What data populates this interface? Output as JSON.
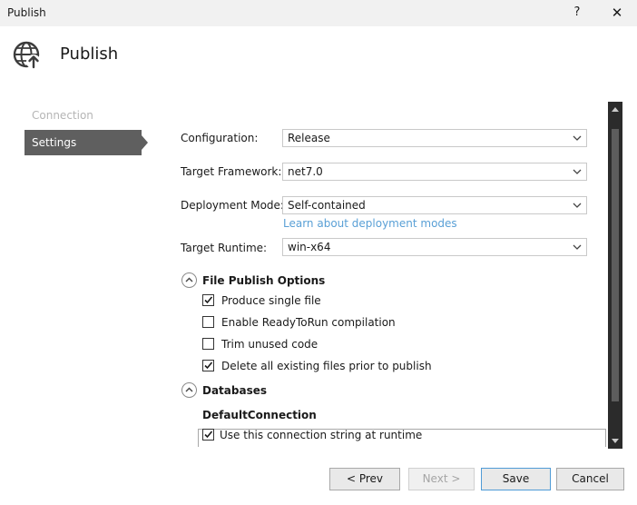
{
  "window": {
    "title": "Publish",
    "help_label": "?",
    "close_label": "✕"
  },
  "header": {
    "title": "Publish",
    "icon": "globe-publish-icon"
  },
  "nav": {
    "connection": "Connection",
    "settings": "Settings"
  },
  "settings": {
    "configuration": {
      "label": "Configuration:",
      "value": "Release"
    },
    "target_framework": {
      "label": "Target Framework:",
      "value": "net7.0"
    },
    "deployment_mode": {
      "label": "Deployment Mode:",
      "value": "Self-contained"
    },
    "deployment_link": "Learn about deployment modes",
    "target_runtime": {
      "label": "Target Runtime:",
      "value": "win-x64"
    }
  },
  "file_publish": {
    "title": "File Publish Options",
    "options": [
      {
        "label": "Produce single file",
        "checked": true
      },
      {
        "label": "Enable ReadyToRun compilation",
        "checked": false
      },
      {
        "label": "Trim unused code",
        "checked": false
      },
      {
        "label": "Delete all existing files prior to publish",
        "checked": true
      }
    ]
  },
  "databases": {
    "title": "Databases",
    "connection_name": "DefaultConnection",
    "use_at_runtime": {
      "label": "Use this connection string at runtime",
      "checked": true
    }
  },
  "buttons": {
    "prev": "< Prev",
    "next": "Next >",
    "save": "Save",
    "cancel": "Cancel"
  }
}
